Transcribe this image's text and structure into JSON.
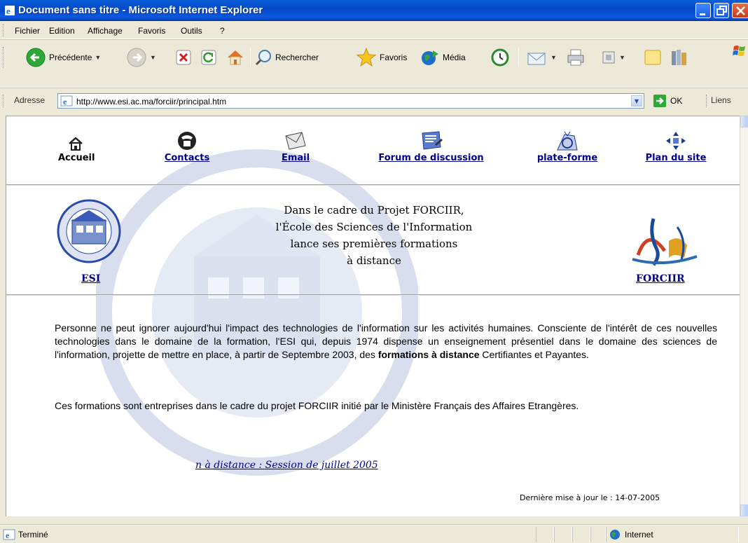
{
  "window": {
    "title": "Document sans titre - Microsoft Internet Explorer"
  },
  "menu": {
    "items": [
      {
        "label": "Fichier",
        "accesskey": "F"
      },
      {
        "label": "Edition",
        "accesskey": "E"
      },
      {
        "label": "Affichage",
        "accesskey": "A"
      },
      {
        "label": "Favoris",
        "accesskey": "o"
      },
      {
        "label": "Outils",
        "accesskey": "O"
      },
      {
        "label": "?",
        "accesskey": "?"
      }
    ]
  },
  "toolbar": {
    "back": "Précédente",
    "search": "Rechercher",
    "favorites": "Favoris",
    "media": "Média"
  },
  "address": {
    "label": "Adresse",
    "url": "http://www.esi.ac.ma/forciir/principal.htm",
    "go": "OK",
    "links": "Liens"
  },
  "page": {
    "nav": [
      {
        "label": "Accueil",
        "icon": "home-icon",
        "link": false
      },
      {
        "label": "Contacts",
        "icon": "telephone-icon",
        "link": true
      },
      {
        "label": "Email",
        "icon": "envelope-icon",
        "link": true
      },
      {
        "label": "Forum de discussion",
        "icon": "forum-icon",
        "link": true
      },
      {
        "label": "plate-forme",
        "icon": "platform-icon",
        "link": true
      },
      {
        "label": "Plan du site",
        "icon": "sitemap-icon",
        "link": true
      }
    ],
    "intro": {
      "line1": "Dans le cadre du Projet FORCIIR,",
      "line2": "l'École des Sciences de l'Information",
      "line3": "lance ses premières formations",
      "line4": "à distance"
    },
    "esi_link": "ESI",
    "forciir_link": "FORCIIR",
    "para1_before": "Personne ne peut ignorer aujourd'hui l'impact des technologies de l'information sur les activités humaines. Consciente de l'intérêt de ces nouvelles technologies dans le domaine de la formation, l'ESI qui, depuis 1974 dispense un enseignement présentiel dans le domaine des sciences de l'information, projette de mettre en place, à partir de Septembre 2003, des ",
    "para1_bold": "formations à distance",
    "para1_after": " Certifiantes et Payantes.",
    "para2": "Ces formations sont entreprises dans le cadre du projet FORCIIR initié par le Ministère Français des Affaires Etrangères.",
    "scroll_text": "n à distance : Session de juillet 2005",
    "last_update": "Dernière mise à jour le : 14-07-2005"
  },
  "status": {
    "text": "Terminé",
    "zone": "Internet"
  }
}
